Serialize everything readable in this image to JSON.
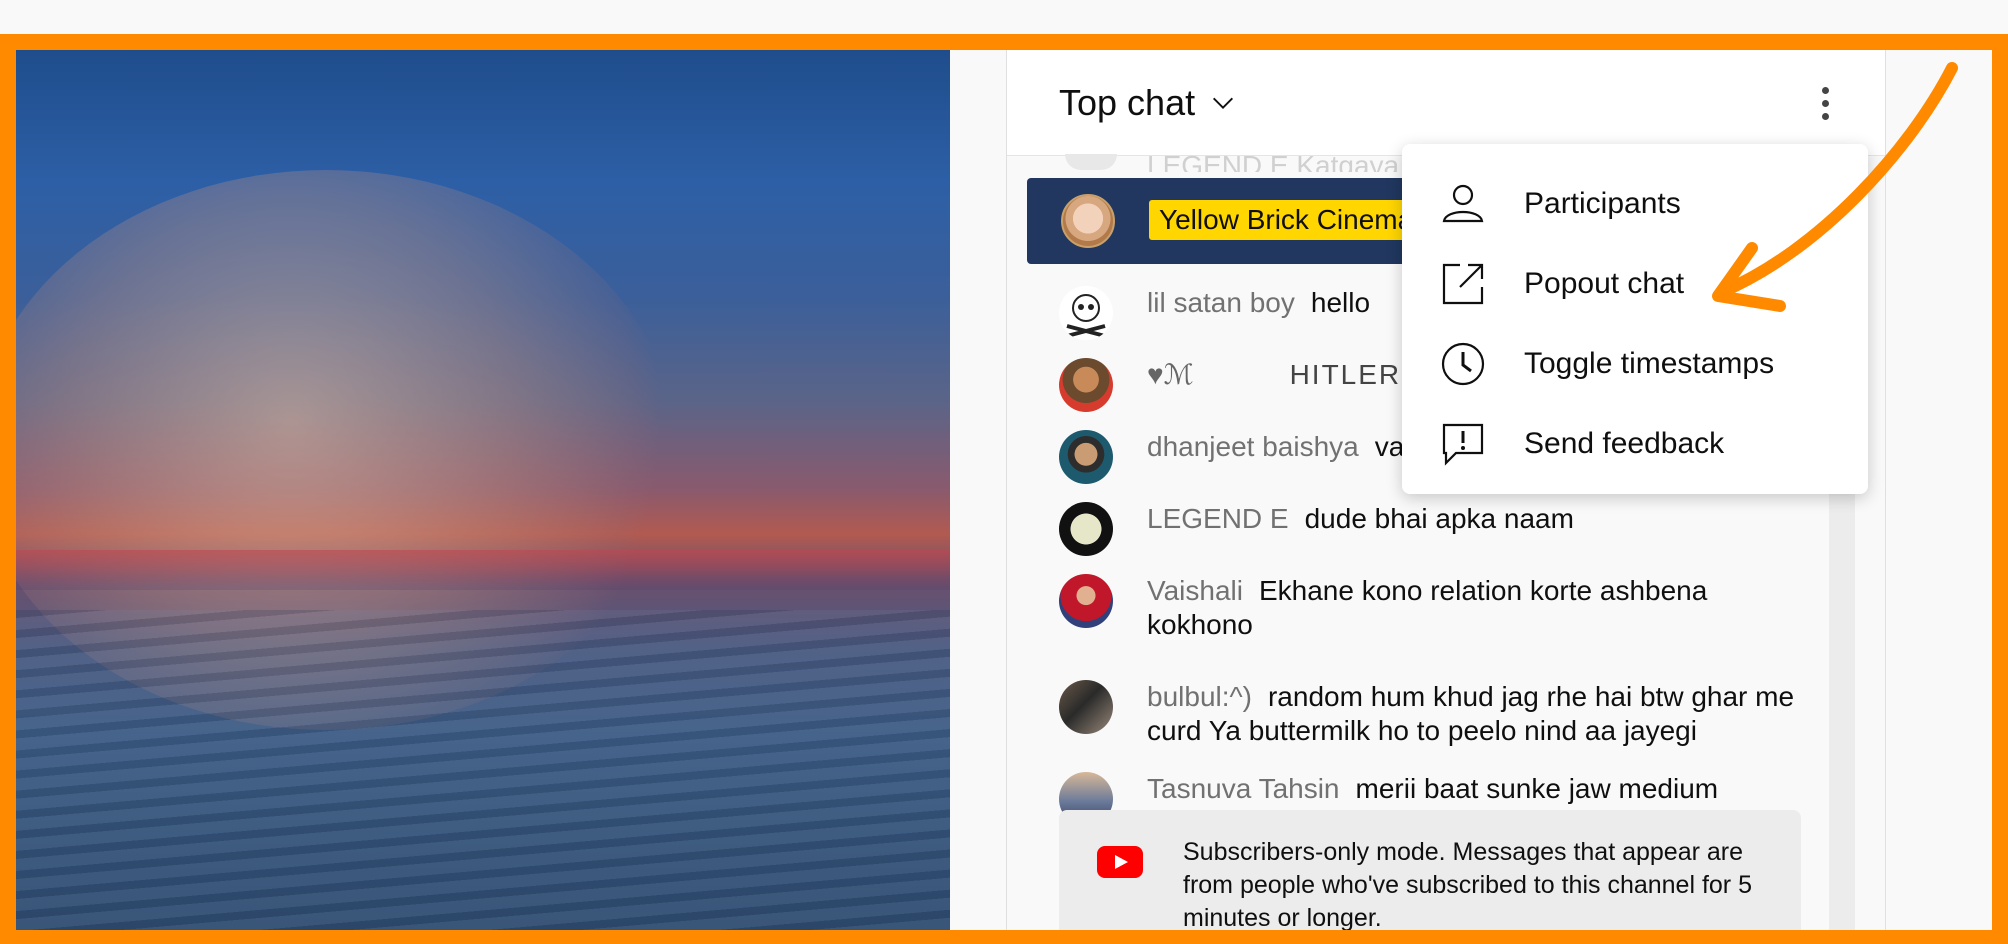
{
  "chat": {
    "title": "Top chat",
    "ghost_text": "LEGEND E  Katgaya",
    "pinned": {
      "name": "Yellow Brick Cinema"
    },
    "messages": [
      {
        "author": "lil satan boy",
        "text": "hello"
      },
      {
        "author": "♥ℳ",
        "text": "HITLER"
      },
      {
        "author": "dhanjeet baishya",
        "text": "va"
      },
      {
        "author": "LEGEND E",
        "text": "dude bhai apka naam"
      },
      {
        "author": "Vaishali",
        "text": "Ekhane kono relation korte ashbena kokhono"
      },
      {
        "author": "bulbul:^)",
        "text": "random hum khud jag rhe hai btw ghar me curd Ya buttermilk ho to peelo nind aa jayegi"
      },
      {
        "author": "Tasnuva Tahsin",
        "text": "merii baat sunke jaw medium"
      }
    ],
    "subscribers_notice": "Subscribers-only mode. Messages that appear are from people who've subscribed to this channel for 5 minutes or longer."
  },
  "menu": {
    "items": [
      {
        "label": "Participants",
        "icon": "person-icon"
      },
      {
        "label": "Popout chat",
        "icon": "popout-icon"
      },
      {
        "label": "Toggle timestamps",
        "icon": "clock-icon"
      },
      {
        "label": "Send feedback",
        "icon": "feedback-icon"
      }
    ]
  },
  "colors": {
    "annotation": "#ff8a00",
    "highlight": "#ffd600",
    "pinned_bg": "#21375f"
  }
}
